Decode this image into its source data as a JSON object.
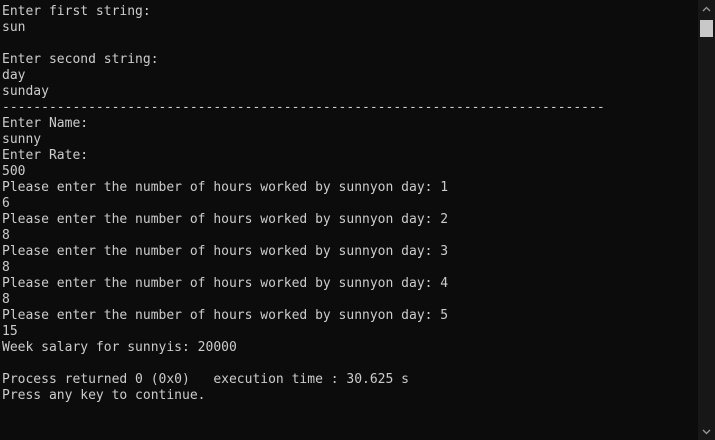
{
  "console": {
    "lines": [
      "Enter first string:",
      "sun",
      "",
      "Enter second string:",
      "day",
      "sunday",
      "-----------------------------------------------------------------------------",
      "Enter Name:",
      "sunny",
      "Enter Rate:",
      "500",
      "Please enter the number of hours worked by sunnyon day: 1",
      "6",
      "Please enter the number of hours worked by sunnyon day: 2",
      "8",
      "Please enter the number of hours worked by sunnyon day: 3",
      "8",
      "Please enter the number of hours worked by sunnyon day: 4",
      "8",
      "Please enter the number of hours worked by sunnyon day: 5",
      "15",
      "Week salary for sunnyis: 20000",
      "",
      "Process returned 0 (0x0)   execution time : 30.625 s",
      "Press any key to continue."
    ]
  },
  "scrollbar": {
    "up_icon": "chevron-up-icon",
    "down_icon": "chevron-down-icon"
  },
  "colors": {
    "background": "#0c0c0c",
    "text": "#cccccc",
    "scrollbar_track": "#171717",
    "scrollbar_thumb": "#c8c8c8"
  }
}
